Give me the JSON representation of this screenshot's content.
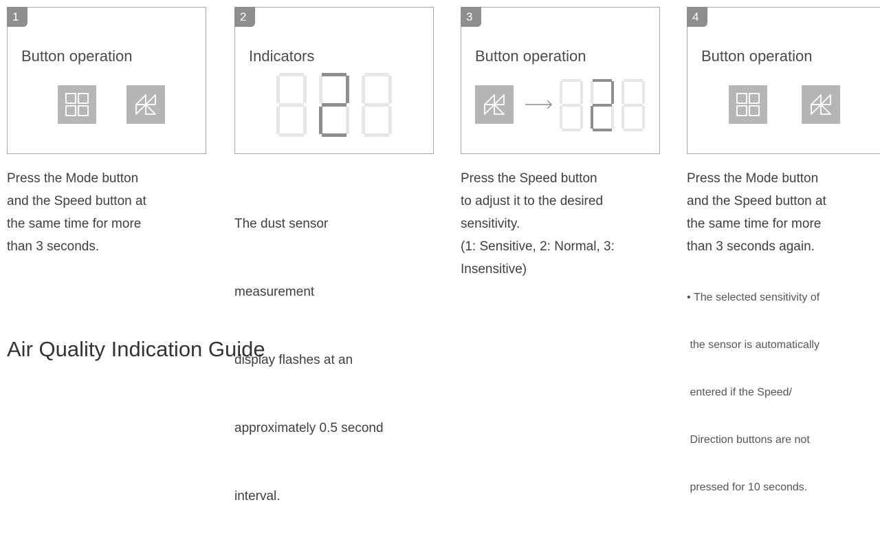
{
  "steps": [
    {
      "number": "1",
      "title": "Button operation",
      "lines": [
        "Press the Mode button",
        "and the Speed button at",
        "the same time for more",
        "than 3 seconds."
      ]
    },
    {
      "number": "2",
      "title": "Indicators",
      "lines": [
        "The dust sensor",
        " measurement",
        " display flashes at an",
        " approximately 0.5 second",
        " interval."
      ]
    },
    {
      "number": "3",
      "title": "Button operation",
      "lines": [
        "Press the Speed button",
        "to adjust it to the desired",
        "sensitivity.",
        "(1: Sensitive, 2: Normal, 3:",
        "Insensitive)"
      ]
    },
    {
      "number": "4",
      "title": "Button operation",
      "lines": [
        "Press the Mode button",
        "and the Speed button at",
        "the same time for more",
        "than 3 seconds again."
      ],
      "note_bullet": "•",
      "note_lines": [
        "The selected sensitivity of",
        " the sensor is automatically",
        " entered if the Speed/",
        " Direction buttons are not",
        " pressed for 10 seconds."
      ]
    }
  ],
  "icons": {
    "mode": "mode-grid-icon",
    "speed": "speed-fan-icon",
    "arrow": "right-arrow-icon"
  },
  "colors": {
    "badge": "#8e8e8e",
    "button": "#b5b5b5",
    "segment_on": "#8e8e8e",
    "segment_off": "#e6e6e6",
    "border": "#a8a8a8"
  },
  "section_title": "Air Quality Indication Guide"
}
